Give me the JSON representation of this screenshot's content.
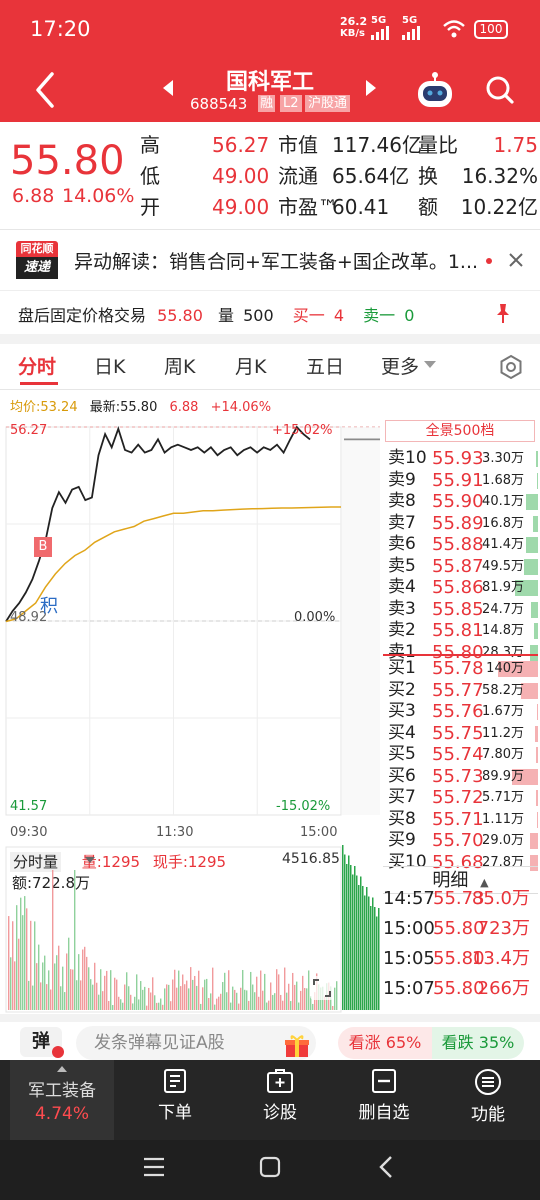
{
  "status": {
    "time": "17:20",
    "speed_top": "26.2",
    "speed_unit": "KB/s",
    "net1": "5G",
    "net2": "5G",
    "battery": "100"
  },
  "header": {
    "title": "国科军工",
    "code": "688543",
    "badges": [
      "融",
      "L2",
      "沪股通"
    ],
    "back_icon": "chevron-left-icon",
    "robot_icon": "robot-icon",
    "search_icon": "search-icon"
  },
  "quote": {
    "price": "55.80",
    "change": "6.88",
    "change_pct": "14.06%",
    "rows": [
      {
        "l1": "高",
        "v1": "56.27",
        "l2": "市值",
        "v2": "117.46亿",
        "l3": "量比",
        "v3": "1.75"
      },
      {
        "l1": "低",
        "v1": "49.00",
        "l2": "流通",
        "v2": "65.64亿",
        "l3": "换",
        "v3": "16.32%"
      },
      {
        "l1": "开",
        "v1": "49.00",
        "l2": "市盈™",
        "v2": "60.41",
        "l3": "额",
        "v3": "10.22亿"
      }
    ]
  },
  "news": {
    "logo_top": "同花顺",
    "logo_bottom": "速递",
    "text": "异动解读：销售合同+军工装备+国企改革。1..."
  },
  "after_hours": {
    "label": "盘后固定价格交易",
    "price": "55.80",
    "vol_label": "量",
    "vol": "500",
    "buy_label": "买一",
    "buy": "4",
    "sell_label": "卖一",
    "sell": "0"
  },
  "tabs": [
    "分时",
    "日K",
    "周K",
    "月K",
    "五日",
    "更多"
  ],
  "chart_info": {
    "avg": "均价:53.24",
    "latest": "最新:55.80",
    "chg": "6.88",
    "pct": "+14.06%"
  },
  "chart_labels": {
    "top_left": "56.27",
    "top_right": "+15.02%",
    "mid_left": "48.92",
    "mid_right": "0.00%",
    "bot_left": "41.57",
    "bot_right": "-15.02%",
    "t1": "09:30",
    "t2": "11:30",
    "t3": "15:00",
    "marker_b": "B",
    "marker_ji": "积"
  },
  "chart_data": {
    "type": "line",
    "title": "",
    "x": [
      "09:30",
      "11:30",
      "15:00"
    ],
    "ylim": [
      41.57,
      56.27
    ],
    "prev_close": 48.92,
    "series": [
      {
        "values": [
          48.9,
          49.3,
          49.6,
          50.0,
          50.5,
          51.2,
          52.0,
          53.2,
          53.8,
          53.4,
          53.9,
          54.0,
          53.5,
          53.6,
          55.2,
          56.0,
          55.5,
          56.2,
          55.4,
          55.3,
          55.6,
          55.3,
          55.4,
          55.8,
          55.3,
          55.5,
          55.6,
          55.5,
          55.4,
          55.5,
          55.3,
          55.5,
          55.2,
          55.4,
          55.5,
          55.2,
          55.4,
          55.5,
          55.3,
          55.5,
          55.4,
          55.6,
          55.3,
          55.8,
          56.27,
          56.0,
          55.8
        ]
      },
      {
        "values": [
          48.9,
          49.0,
          49.3,
          49.6,
          50.2,
          50.7,
          51.1,
          51.4,
          51.6,
          51.9,
          52.1,
          52.3,
          52.4,
          52.5,
          52.7,
          52.8,
          52.9,
          53.0,
          53.0,
          53.05,
          53.1,
          53.1,
          53.12,
          53.14,
          53.16,
          53.17,
          53.18,
          53.19,
          53.2,
          53.2,
          53.21,
          53.22,
          53.23,
          53.24,
          53.24
        ]
      }
    ]
  },
  "orderbook": {
    "title": "全景500档",
    "asks": [
      {
        "l": "卖10",
        "p": "55.93",
        "v": "3.30万",
        "f": 0.04
      },
      {
        "l": "卖9",
        "p": "55.91",
        "v": "1.68万",
        "f": 0.02
      },
      {
        "l": "卖8",
        "p": "55.90",
        "v": "40.1万",
        "f": 0.29
      },
      {
        "l": "卖7",
        "p": "55.89",
        "v": "16.8万",
        "f": 0.12
      },
      {
        "l": "卖6",
        "p": "55.88",
        "v": "41.4万",
        "f": 0.3
      },
      {
        "l": "卖5",
        "p": "55.87",
        "v": "49.5万",
        "f": 0.35
      },
      {
        "l": "卖4",
        "p": "55.86",
        "v": "81.9万",
        "f": 0.58
      },
      {
        "l": "卖3",
        "p": "55.85",
        "v": "24.7万",
        "f": 0.18
      },
      {
        "l": "卖2",
        "p": "55.81",
        "v": "14.8万",
        "f": 0.11
      },
      {
        "l": "卖1",
        "p": "55.80",
        "v": "28.3万",
        "f": 0.2
      }
    ],
    "bids": [
      {
        "l": "买1",
        "p": "55.78",
        "v": "140万",
        "f": 1.0
      },
      {
        "l": "买2",
        "p": "55.77",
        "v": "58.2万",
        "f": 0.42
      },
      {
        "l": "买3",
        "p": "55.76",
        "v": "1.67万",
        "f": 0.02
      },
      {
        "l": "买4",
        "p": "55.75",
        "v": "11.2万",
        "f": 0.08
      },
      {
        "l": "买5",
        "p": "55.74",
        "v": "7.80万",
        "f": 0.06
      },
      {
        "l": "买6",
        "p": "55.73",
        "v": "89.9万",
        "f": 0.64
      },
      {
        "l": "买7",
        "p": "55.72",
        "v": "5.71万",
        "f": 0.04
      },
      {
        "l": "买8",
        "p": "55.71",
        "v": "1.11万",
        "f": 0.01
      },
      {
        "l": "买9",
        "p": "55.70",
        "v": "29.0万",
        "f": 0.21
      },
      {
        "l": "买10",
        "p": "55.68",
        "v": "27.8万",
        "f": 0.2
      }
    ]
  },
  "volume": {
    "label": "分时量",
    "vol": "量:1295",
    "now": "现手:1295",
    "max": "4516.85",
    "amount": "额:722.8万"
  },
  "ticks": {
    "title": "明细",
    "rows": [
      {
        "t": "14:57",
        "p": "55.73",
        "v": "85.0万"
      },
      {
        "t": "15:00",
        "p": "55.80",
        "v": "723万"
      },
      {
        "t": "15:05",
        "p": "55.80",
        "v": "13.4万"
      },
      {
        "t": "15:07",
        "p": "55.80",
        "v": "266万"
      }
    ]
  },
  "danmu": {
    "icon": "弹",
    "placeholder": "发条弹幕见证A股",
    "up": "看涨 65%",
    "down": "看跌 35%"
  },
  "bottom_nav": {
    "sector": "军工装备",
    "sector_pct": "4.74%",
    "items": [
      "下单",
      "诊股",
      "删自选",
      "功能"
    ]
  },
  "colors": {
    "red": "#e8343a",
    "green": "#1a9a3a",
    "dark": "#222222"
  }
}
